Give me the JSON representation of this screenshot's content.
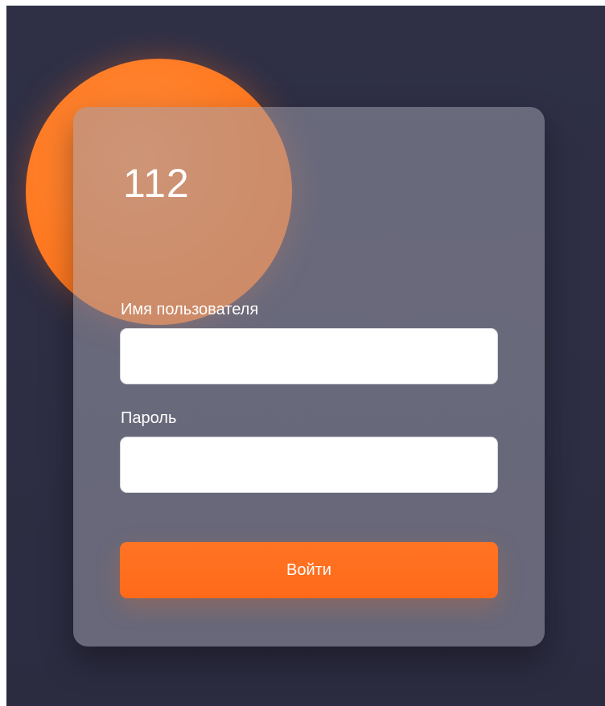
{
  "brand": {
    "title": "112"
  },
  "form": {
    "username": {
      "label": "Имя пользователя",
      "value": "",
      "placeholder": ""
    },
    "password": {
      "label": "Пароль",
      "value": "",
      "placeholder": ""
    },
    "submit_label": "Войти"
  },
  "colors": {
    "background": "#2f3046",
    "accent": "#ff6a19",
    "card": "#6a6a7d",
    "input_background": "#ffffff"
  }
}
